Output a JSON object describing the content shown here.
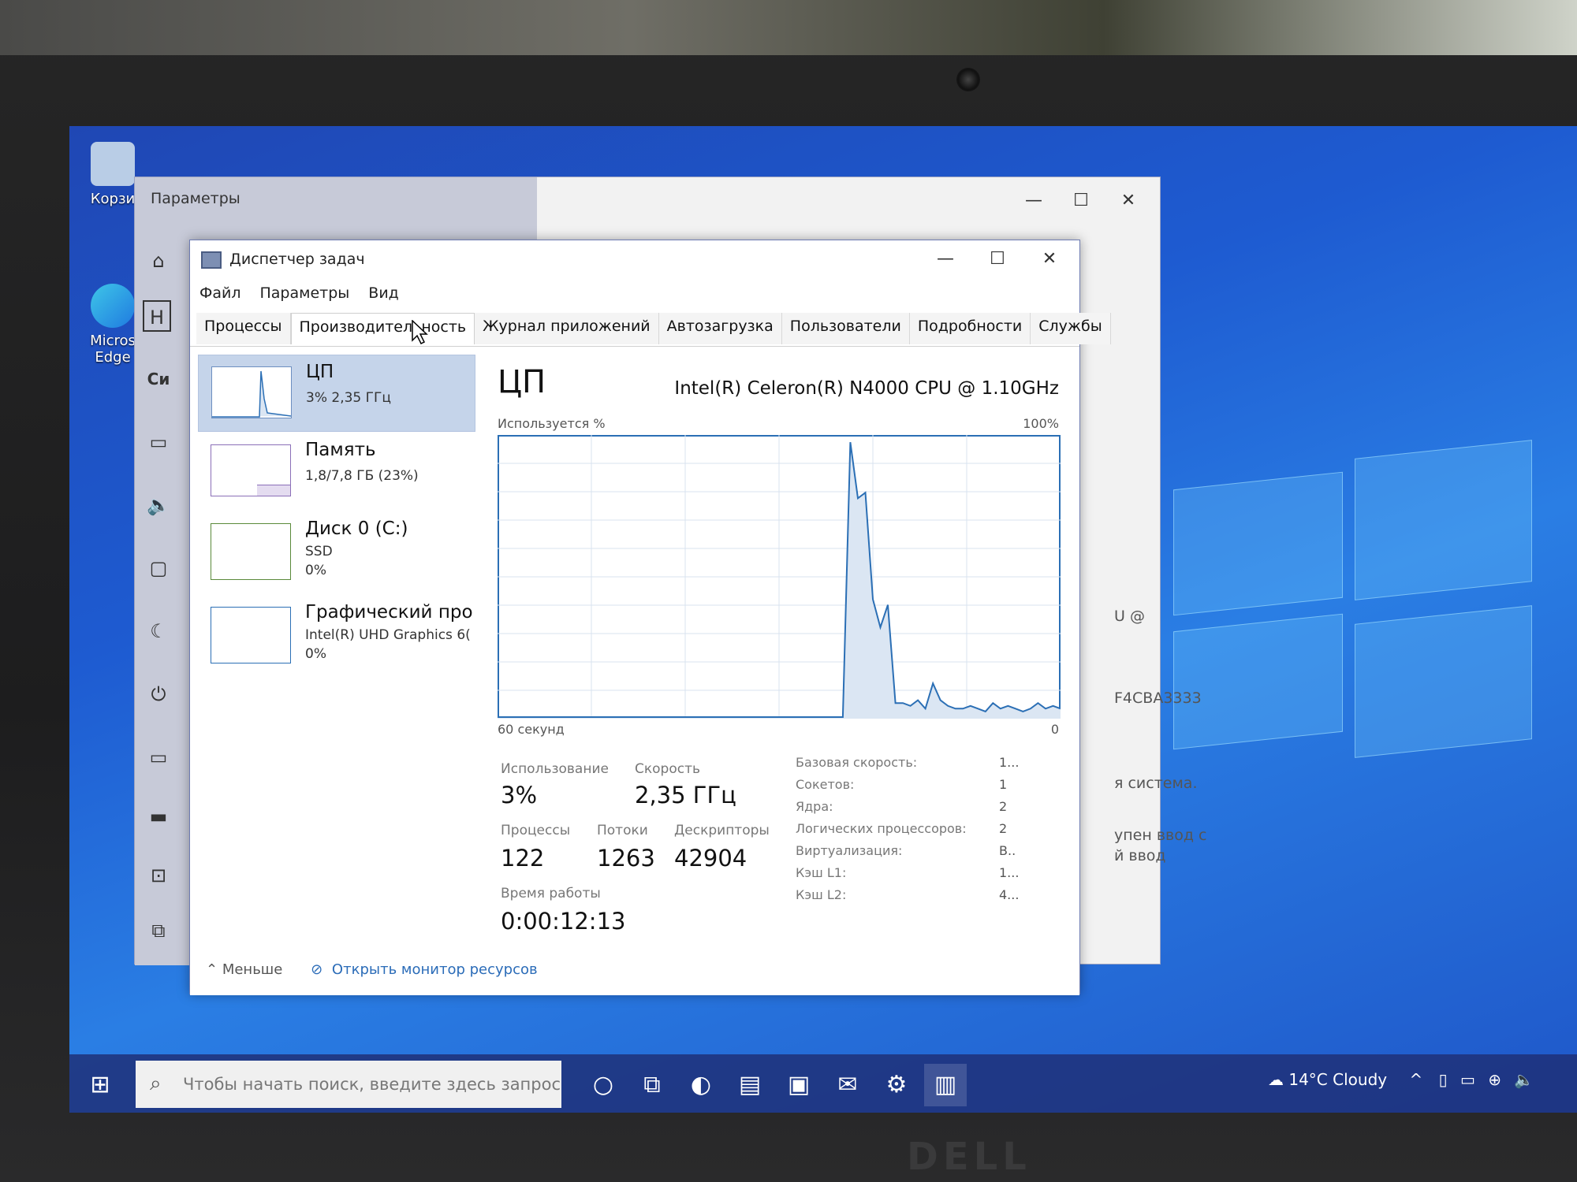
{
  "desktop": {
    "icons": [
      {
        "label": "Корзи"
      },
      {
        "label": "Micros Edge"
      }
    ]
  },
  "settings_window": {
    "title": "Параметры",
    "controls": {
      "minimize": "—",
      "maximize": "☐",
      "close": "✕"
    },
    "partial_left_text": "Си",
    "partial_box_text": "Н",
    "right_text": [
      "U @",
      "F4CBA3333",
      "я система.",
      "упен ввод с",
      "й ввод"
    ]
  },
  "task_manager": {
    "title": "Диспетчер задач",
    "controls": {
      "minimize": "—",
      "maximize": "☐",
      "close": "✕"
    },
    "menu": [
      "Файл",
      "Параметры",
      "Вид"
    ],
    "tabs": [
      "Процессы",
      "Производительность",
      "Журнал приложений",
      "Автозагрузка",
      "Пользователи",
      "Подробности",
      "Службы"
    ],
    "active_tab": "Производительность",
    "resources": [
      {
        "name": "ЦП",
        "sub1": "3% 2,35 ГГц",
        "sub2": "",
        "selected": true
      },
      {
        "name": "Память",
        "sub1": "1,8/7,8 ГБ (23%)",
        "sub2": "",
        "selected": false
      },
      {
        "name": "Диск 0 (C:)",
        "sub1": "SSD",
        "sub2": "0%",
        "selected": false
      },
      {
        "name": "Графический про",
        "sub1": "Intel(R) UHD Graphics 6(",
        "sub2": "0%",
        "selected": false
      }
    ],
    "cpu": {
      "heading": "ЦП",
      "model": "Intel(R) Celeron(R) N4000 CPU @ 1.10GHz",
      "util_label": "Используется %",
      "util_max": "100%",
      "time_label": "60 секунд",
      "time_zero": "0",
      "graph_usage_percent": [
        0,
        0,
        0,
        0,
        0,
        0,
        0,
        0,
        0,
        0,
        0,
        0,
        0,
        0,
        0,
        0,
        0,
        0,
        0,
        0,
        0,
        0,
        0,
        0,
        0,
        0,
        0,
        0,
        0,
        0,
        0,
        0,
        0,
        0,
        0,
        0,
        0,
        0,
        0,
        0,
        0,
        0,
        0,
        0,
        0,
        0,
        0,
        98,
        78,
        80,
        42,
        32,
        40,
        5,
        5,
        4,
        6,
        3,
        12,
        6,
        4,
        3,
        3,
        4,
        3,
        2,
        5,
        3,
        4,
        3,
        2,
        3,
        5,
        3,
        4,
        3
      ],
      "stats": {
        "usage_label": "Использование",
        "usage_value": "3%",
        "speed_label": "Скорость",
        "speed_value": "2,35 ГГц",
        "processes_label": "Процессы",
        "processes_value": "122",
        "threads_label": "Потоки",
        "threads_value": "1263",
        "handles_label": "Дескрипторы",
        "handles_value": "42904",
        "uptime_label": "Время работы",
        "uptime_value": "0:00:12:13"
      },
      "specs": [
        {
          "k": "Базовая скорость:",
          "v": "1..."
        },
        {
          "k": "Сокетов:",
          "v": "1"
        },
        {
          "k": "Ядра:",
          "v": "2"
        },
        {
          "k": "Логических процессоров:",
          "v": "2"
        },
        {
          "k": "Виртуализация:",
          "v": "В.."
        },
        {
          "k": "Кэш L1:",
          "v": "1..."
        },
        {
          "k": "Кэш L2:",
          "v": "4..."
        }
      ]
    },
    "footer": {
      "less": "Меньше",
      "monitor_link": "Открыть монитор ресурсов"
    }
  },
  "taskbar": {
    "search_placeholder": "Чтобы начать поиск, введите здесь запрос",
    "weather": "14°C Cloudy"
  },
  "hardware": {
    "brand": "DELL"
  },
  "colors": {
    "graph_line": "#2b6fb5",
    "graph_fill": "#dbe6f3",
    "selected_item": "#c5d4ea"
  }
}
